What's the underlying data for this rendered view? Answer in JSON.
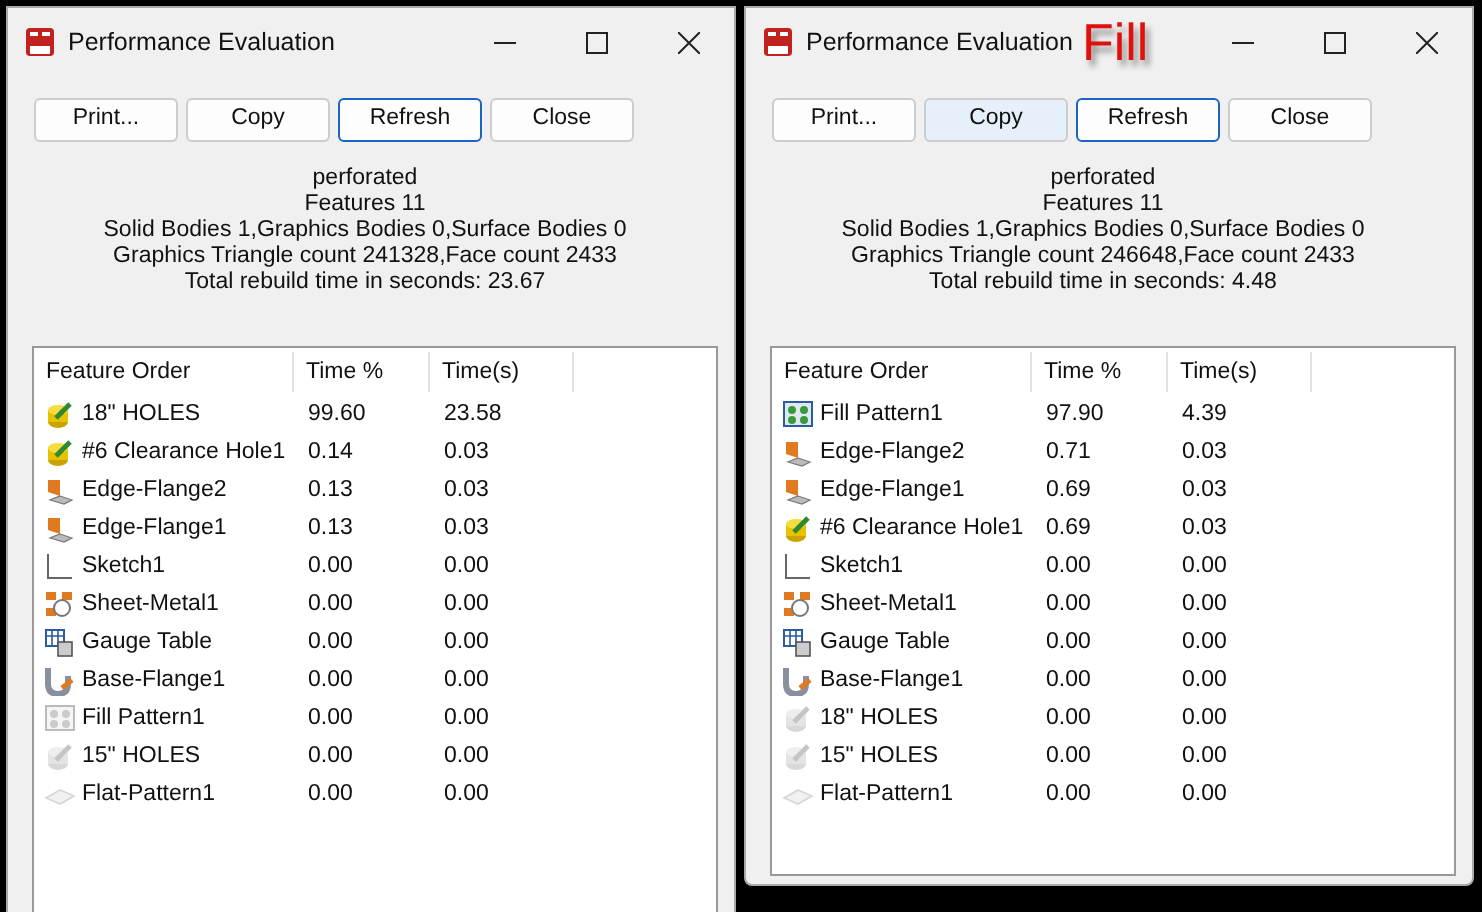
{
  "windows": [
    {
      "title": "Performance Evaluation",
      "buttons": [
        {
          "label": "Print...",
          "focused": false,
          "hovered": false
        },
        {
          "label": "Copy",
          "focused": false,
          "hovered": false
        },
        {
          "label": "Refresh",
          "focused": true,
          "hovered": false
        },
        {
          "label": "Close",
          "focused": false,
          "hovered": false
        }
      ],
      "info": [
        "perforated",
        "Features 11",
        "Solid Bodies 1,Graphics Bodies 0,Surface Bodies 0",
        "Graphics Triangle count 241328,Face count 2433",
        "Total rebuild time in seconds: 23.67"
      ],
      "columns": [
        "Feature Order",
        "Time %",
        "Time(s)"
      ],
      "rows": [
        {
          "kind": "hole",
          "suppressed": false,
          "name": "18\" HOLES",
          "percent": "99.60",
          "seconds": "23.58"
        },
        {
          "kind": "hole",
          "suppressed": false,
          "name": "#6 Clearance Hole1",
          "percent": "0.14",
          "seconds": "0.03"
        },
        {
          "kind": "flange",
          "suppressed": false,
          "name": "Edge-Flange2",
          "percent": "0.13",
          "seconds": "0.03"
        },
        {
          "kind": "flange",
          "suppressed": false,
          "name": "Edge-Flange1",
          "percent": "0.13",
          "seconds": "0.03"
        },
        {
          "kind": "sketch",
          "suppressed": false,
          "name": "Sketch1",
          "percent": "0.00",
          "seconds": "0.00"
        },
        {
          "kind": "sheet-metal",
          "suppressed": false,
          "name": "Sheet-Metal1",
          "percent": "0.00",
          "seconds": "0.00"
        },
        {
          "kind": "gauge-table",
          "suppressed": false,
          "name": "Gauge Table",
          "percent": "0.00",
          "seconds": "0.00"
        },
        {
          "kind": "base-flange",
          "suppressed": false,
          "name": "Base-Flange1",
          "percent": "0.00",
          "seconds": "0.00"
        },
        {
          "kind": "fill-pattern",
          "suppressed": true,
          "name": "Fill Pattern1",
          "percent": "0.00",
          "seconds": "0.00"
        },
        {
          "kind": "hole",
          "suppressed": true,
          "name": "15\" HOLES",
          "percent": "0.00",
          "seconds": "0.00"
        },
        {
          "kind": "flat-pattern",
          "suppressed": true,
          "name": "Flat-Pattern1",
          "percent": "0.00",
          "seconds": "0.00"
        }
      ]
    },
    {
      "title": "Performance Evaluation",
      "annotation": "Fill",
      "buttons": [
        {
          "label": "Print...",
          "focused": false,
          "hovered": false
        },
        {
          "label": "Copy",
          "focused": false,
          "hovered": true
        },
        {
          "label": "Refresh",
          "focused": true,
          "hovered": false
        },
        {
          "label": "Close",
          "focused": false,
          "hovered": false
        }
      ],
      "info": [
        "perforated",
        "Features 11",
        "Solid Bodies 1,Graphics Bodies 0,Surface Bodies 0",
        "Graphics Triangle count 246648,Face count 2433",
        "Total rebuild time in seconds: 4.48"
      ],
      "columns": [
        "Feature Order",
        "Time %",
        "Time(s)"
      ],
      "rows": [
        {
          "kind": "fill-pattern",
          "suppressed": false,
          "name": "Fill Pattern1",
          "percent": "97.90",
          "seconds": "4.39"
        },
        {
          "kind": "flange",
          "suppressed": false,
          "name": "Edge-Flange2",
          "percent": "0.71",
          "seconds": "0.03"
        },
        {
          "kind": "flange",
          "suppressed": false,
          "name": "Edge-Flange1",
          "percent": "0.69",
          "seconds": "0.03"
        },
        {
          "kind": "hole",
          "suppressed": false,
          "name": "#6 Clearance Hole1",
          "percent": "0.69",
          "seconds": "0.03"
        },
        {
          "kind": "sketch",
          "suppressed": false,
          "name": "Sketch1",
          "percent": "0.00",
          "seconds": "0.00"
        },
        {
          "kind": "sheet-metal",
          "suppressed": false,
          "name": "Sheet-Metal1",
          "percent": "0.00",
          "seconds": "0.00"
        },
        {
          "kind": "gauge-table",
          "suppressed": false,
          "name": "Gauge Table",
          "percent": "0.00",
          "seconds": "0.00"
        },
        {
          "kind": "base-flange",
          "suppressed": false,
          "name": "Base-Flange1",
          "percent": "0.00",
          "seconds": "0.00"
        },
        {
          "kind": "hole",
          "suppressed": true,
          "name": "18\" HOLES",
          "percent": "0.00",
          "seconds": "0.00"
        },
        {
          "kind": "hole",
          "suppressed": true,
          "name": "15\" HOLES",
          "percent": "0.00",
          "seconds": "0.00"
        },
        {
          "kind": "flat-pattern",
          "suppressed": true,
          "name": "Flat-Pattern1",
          "percent": "0.00",
          "seconds": "0.00"
        }
      ]
    }
  ]
}
